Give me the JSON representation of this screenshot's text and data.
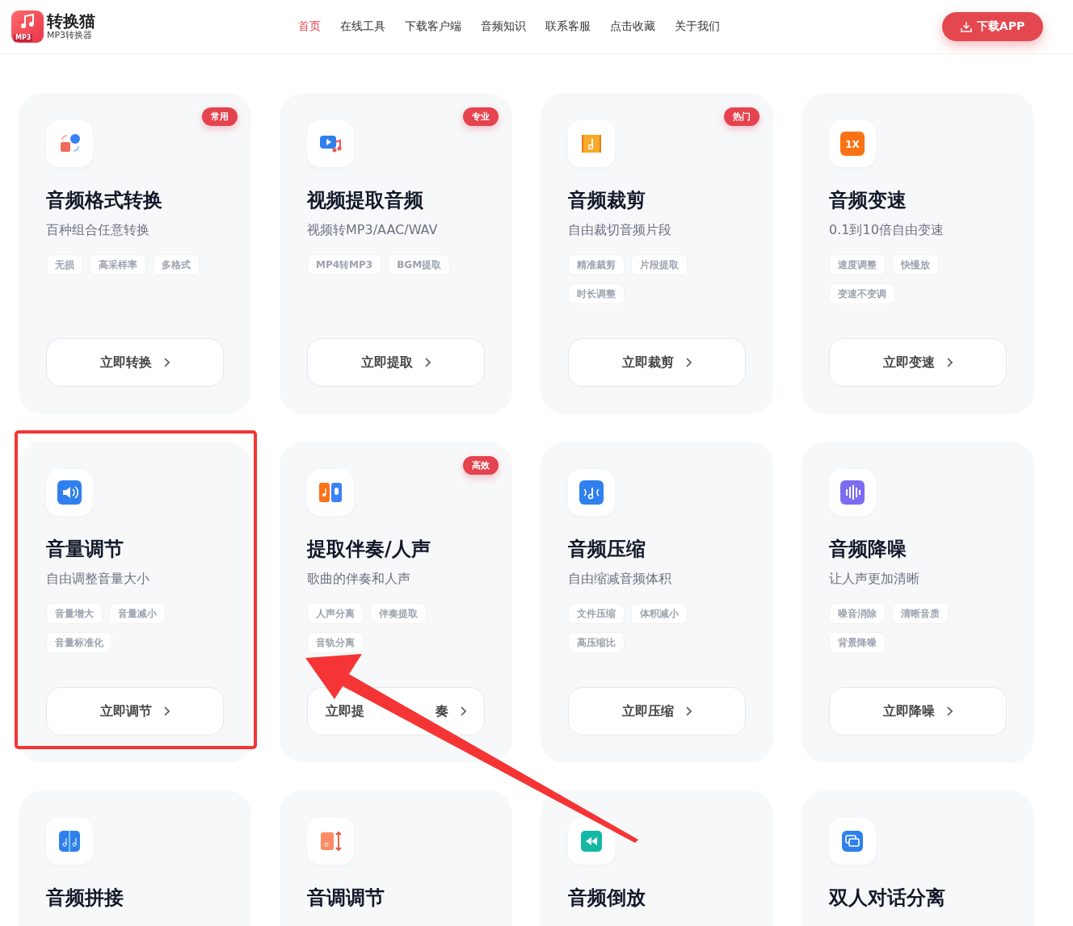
{
  "header": {
    "logo_title": "转换猫",
    "logo_subtitle": "MP3转换器",
    "logo_badge": "MP3",
    "nav": [
      {
        "label": "首页",
        "selected": true
      },
      {
        "label": "在线工具",
        "selected": false
      },
      {
        "label": "下载客户端",
        "selected": false
      },
      {
        "label": "音频知识",
        "selected": false
      },
      {
        "label": "联系客服",
        "selected": false
      },
      {
        "label": "点击收藏",
        "selected": false
      },
      {
        "label": "关于我们",
        "selected": false
      }
    ],
    "download_button": "下载APP"
  },
  "cards": [
    {
      "title": "音频格式转换",
      "subtitle": "百种组合任意转换",
      "badge": "常用",
      "tags": [
        "无损",
        "高采样率",
        "多格式"
      ],
      "button": "立即转换"
    },
    {
      "title": "视频提取音频",
      "subtitle": "视频转MP3/AAC/WAV",
      "badge": "专业",
      "tags": [
        "MP4转MP3",
        "BGM提取"
      ],
      "button": "立即提取"
    },
    {
      "title": "音频裁剪",
      "subtitle": "自由裁切音频片段",
      "badge": "热门",
      "tags": [
        "精准裁剪",
        "片段提取",
        "时长调整"
      ],
      "button": "立即裁剪"
    },
    {
      "title": "音频变速",
      "subtitle": "0.1到10倍自由变速",
      "icon_text": "1X",
      "tags": [
        "速度调整",
        "快慢放",
        "变速不变调"
      ],
      "button": "立即变速"
    },
    {
      "title": "音量调节",
      "subtitle": "自由调整音量大小",
      "tags": [
        "音量增大",
        "音量减小",
        "音量标准化"
      ],
      "button": "立即调节"
    },
    {
      "title": "提取伴奏/人声",
      "subtitle": "歌曲的伴奏和人声",
      "badge": "高效",
      "tags": [
        "人声分离",
        "伴奏提取",
        "音轨分离"
      ],
      "button": "立即提",
      "button_after_gap": "奏"
    },
    {
      "title": "音频压缩",
      "subtitle": "自由缩减音频体积",
      "tags": [
        "文件压缩",
        "体积减小",
        "高压缩比"
      ],
      "button": "立即压缩"
    },
    {
      "title": "音频降噪",
      "subtitle": "让人声更加清晰",
      "tags": [
        "噪音消除",
        "清晰音质",
        "背景降噪"
      ],
      "button": "立即降噪"
    },
    {
      "title": "音频拼接"
    },
    {
      "title": "音调调节"
    },
    {
      "title": "音频倒放"
    },
    {
      "title": "双人对话分离"
    }
  ]
}
